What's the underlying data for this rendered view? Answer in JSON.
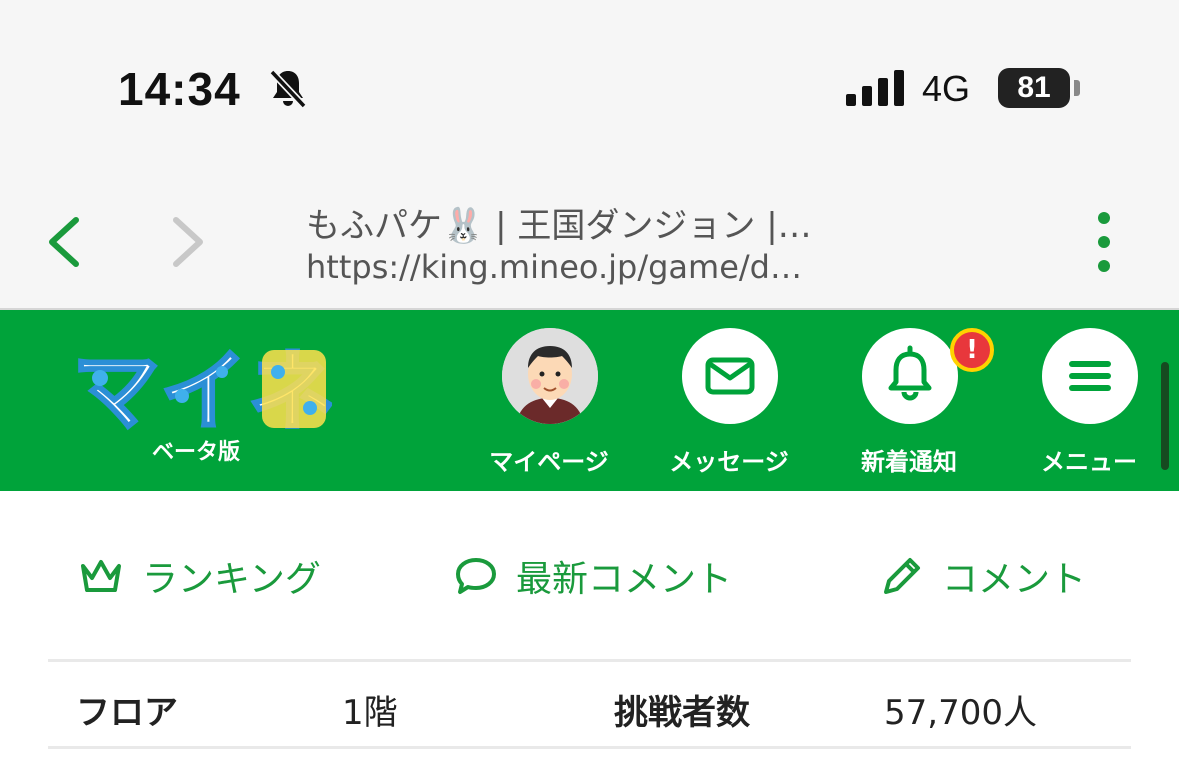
{
  "status_bar": {
    "time": "14:34",
    "network": "4G",
    "battery": "81"
  },
  "browser": {
    "title": "もふパケ🐰 | 王国ダンジョン |…",
    "url": "https://king.mineo.jp/game/d…"
  },
  "header": {
    "logo_text": "マイネ王",
    "logo_sub": "ベータ版",
    "nav": [
      {
        "label": "マイページ",
        "icon": "avatar"
      },
      {
        "label": "メッセージ",
        "icon": "mail-icon"
      },
      {
        "label": "新着通知",
        "icon": "bell-icon",
        "badge": "!"
      },
      {
        "label": "メニュー",
        "icon": "hamburger-icon"
      }
    ]
  },
  "actions": [
    {
      "label": "ランキング",
      "icon": "crown-icon"
    },
    {
      "label": "最新コメント",
      "icon": "speech-bubble-icon"
    },
    {
      "label": "コメント",
      "icon": "pencil-icon"
    }
  ],
  "info": {
    "floor_label": "フロア",
    "floor_value": "1階",
    "challengers_label": "挑戦者数",
    "challengers_value": "57,700人"
  },
  "colors": {
    "brand_green": "#00a33a",
    "action_green": "#1a9a3c",
    "alert_red": "#e8373c",
    "logo_yellow": "#ffe14d",
    "logo_blue": "#3fb0ec"
  }
}
